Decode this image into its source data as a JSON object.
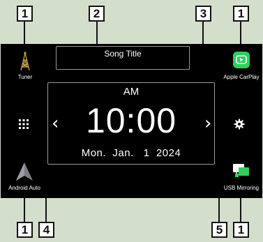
{
  "callouts": {
    "tuner": "1",
    "song_title": "2",
    "clock": "3",
    "apple_carplay": "1",
    "android_auto": "1",
    "menu": "4",
    "settings": "5",
    "usb_mirroring": "1"
  },
  "sources": {
    "tuner": "Tuner",
    "apple_carplay": "Apple CarPlay",
    "android_auto": "Android Auto",
    "usb_mirroring": "USB Mirroring"
  },
  "now_playing": {
    "song_title": "Song Title"
  },
  "clock": {
    "ampm": "AM",
    "time": "10:00",
    "date": "Mon.  Jan.   1  2024"
  },
  "icons": {
    "tuner": "tuner-tower-icon",
    "apple_carplay": "carplay-icon",
    "android_auto": "android-auto-icon",
    "usb_mirroring": "usb-mirroring-icon",
    "menu": "grid-menu-icon",
    "settings": "gear-icon",
    "prev": "chevron-left-icon",
    "next": "chevron-right-icon"
  },
  "colors": {
    "background": "#d4dfcb",
    "screen": "#000000",
    "accent_carplay": "#2fd158",
    "tuner_icon": "#c8a24a",
    "android_icon": "#7a7d85"
  }
}
